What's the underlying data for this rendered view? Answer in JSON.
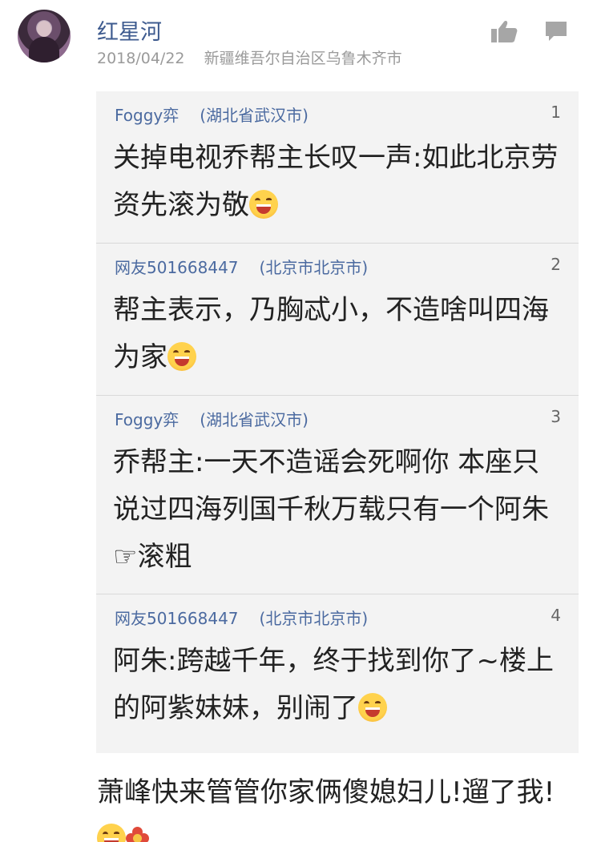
{
  "post": {
    "username": "红星河",
    "date": "2018/04/22",
    "location": "新疆维吾尔自治区乌鲁木齐市",
    "icons": {
      "like": "thumbs-up-icon",
      "comment": "comment-icon"
    }
  },
  "quotes": [
    {
      "user": "Foggy弈",
      "location": "(湖北省武汉市)",
      "number": "1",
      "text": "关掉电视乔帮主长叹一声:如此北京劳资先滚为敬",
      "emoji": "grinning-face-icon"
    },
    {
      "user": "网友501668447",
      "location": "(北京市北京市)",
      "number": "2",
      "text": "帮主表示，乃胸忒小，不造啥叫四海为家",
      "emoji": "grinning-face-icon"
    },
    {
      "user": "Foggy弈",
      "location": "(湖北省武汉市)",
      "number": "3",
      "text": "乔帮主:一天不造谣会死啊你 本座只说过四海列国千秋万载只有一个阿朱☞滚粗"
    },
    {
      "user": "网友501668447",
      "location": "(北京市北京市)",
      "number": "4",
      "text": "阿朱:跨越千年，终于找到你了~楼上的阿紫妹妹，别闹了",
      "emoji": "grinning-face-icon"
    }
  ],
  "main_text": "萧峰快来管管你家俩傻媳妇儿!遛了我!",
  "colors": {
    "username": "#3e5b8f",
    "quote_user": "#4b6aa0",
    "meta": "#9a9a9a",
    "quote_bg": "#f3f3f3"
  }
}
